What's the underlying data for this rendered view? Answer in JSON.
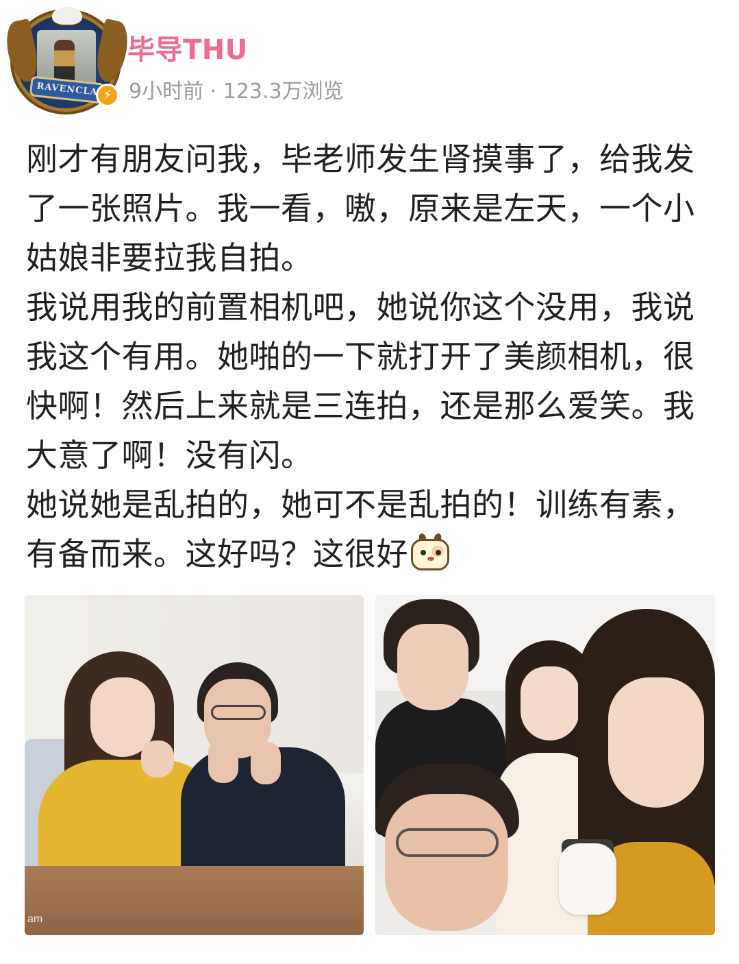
{
  "header": {
    "username": "毕导THU",
    "meta": "9小时前 · 123.3万浏览",
    "avatar_banner": "RAVENCLA",
    "verified_badge": "⚡"
  },
  "post": {
    "paragraphs": [
      "刚才有朋友问我，毕老师发生肾摸事了，给我发了一张照片。我一看，嗷，原来是左天，一个小姑娘非要拉我自拍。",
      "我说用我的前置相机吧，她说你这个没用，我说我这个有用。她啪的一下就打开了美颜相机，很快啊！然后上来就是三连拍，还是那么爱笑。我大意了啊！没有闪。",
      "她说她是乱拍的，她可不是乱拍的！训练有素，有备而来。这好吗？这很好"
    ],
    "emoji_name": "dog-emoji-icon"
  },
  "images": {
    "photo_1_watermark": "am"
  },
  "colors": {
    "username": "#ef6c8e",
    "meta": "#9a9a9a",
    "text": "#202020"
  }
}
